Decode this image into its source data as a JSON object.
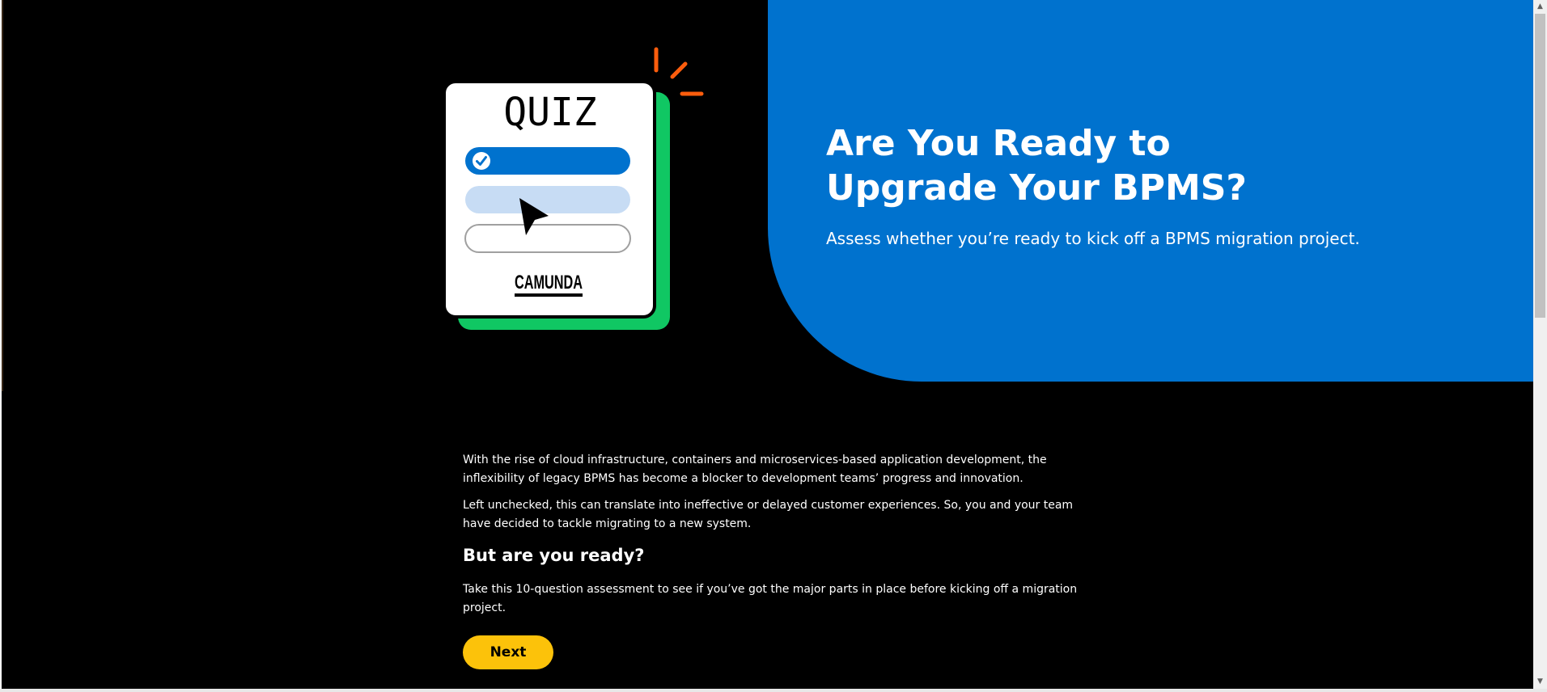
{
  "hero": {
    "title": "Are You Ready to Upgrade Your BPMS?",
    "subtitle": "Assess whether you’re ready to kick off a BPMS migration project."
  },
  "illustration": {
    "heading": "QUIZ",
    "brand": "CAMUNDA",
    "icons": [
      "checkmark-icon",
      "cursor-arrow-icon",
      "spark-icon"
    ],
    "colors": {
      "blue": "#0072ce",
      "light_blue": "#c7dcf4",
      "green": "#10c763",
      "orange": "#fc5d0d"
    }
  },
  "body": {
    "paragraph_1": "With the rise of cloud infrastructure, containers and microservices-based application development, the inflexibility of legacy BPMS has become a blocker to development teams’ progress and innovation.",
    "paragraph_2": "Left unchecked, this can translate into ineffective or delayed customer experiences. So, you and your team have decided to tackle migrating to a new system.",
    "question": "But are you ready?",
    "paragraph_3": "Take this 10-question assessment to see if you’ve got the major parts in place before kicking off a migration project.",
    "next_label": "Next"
  },
  "colors": {
    "background": "#000000",
    "hero": "#0072ce",
    "button": "#fcc20a"
  }
}
